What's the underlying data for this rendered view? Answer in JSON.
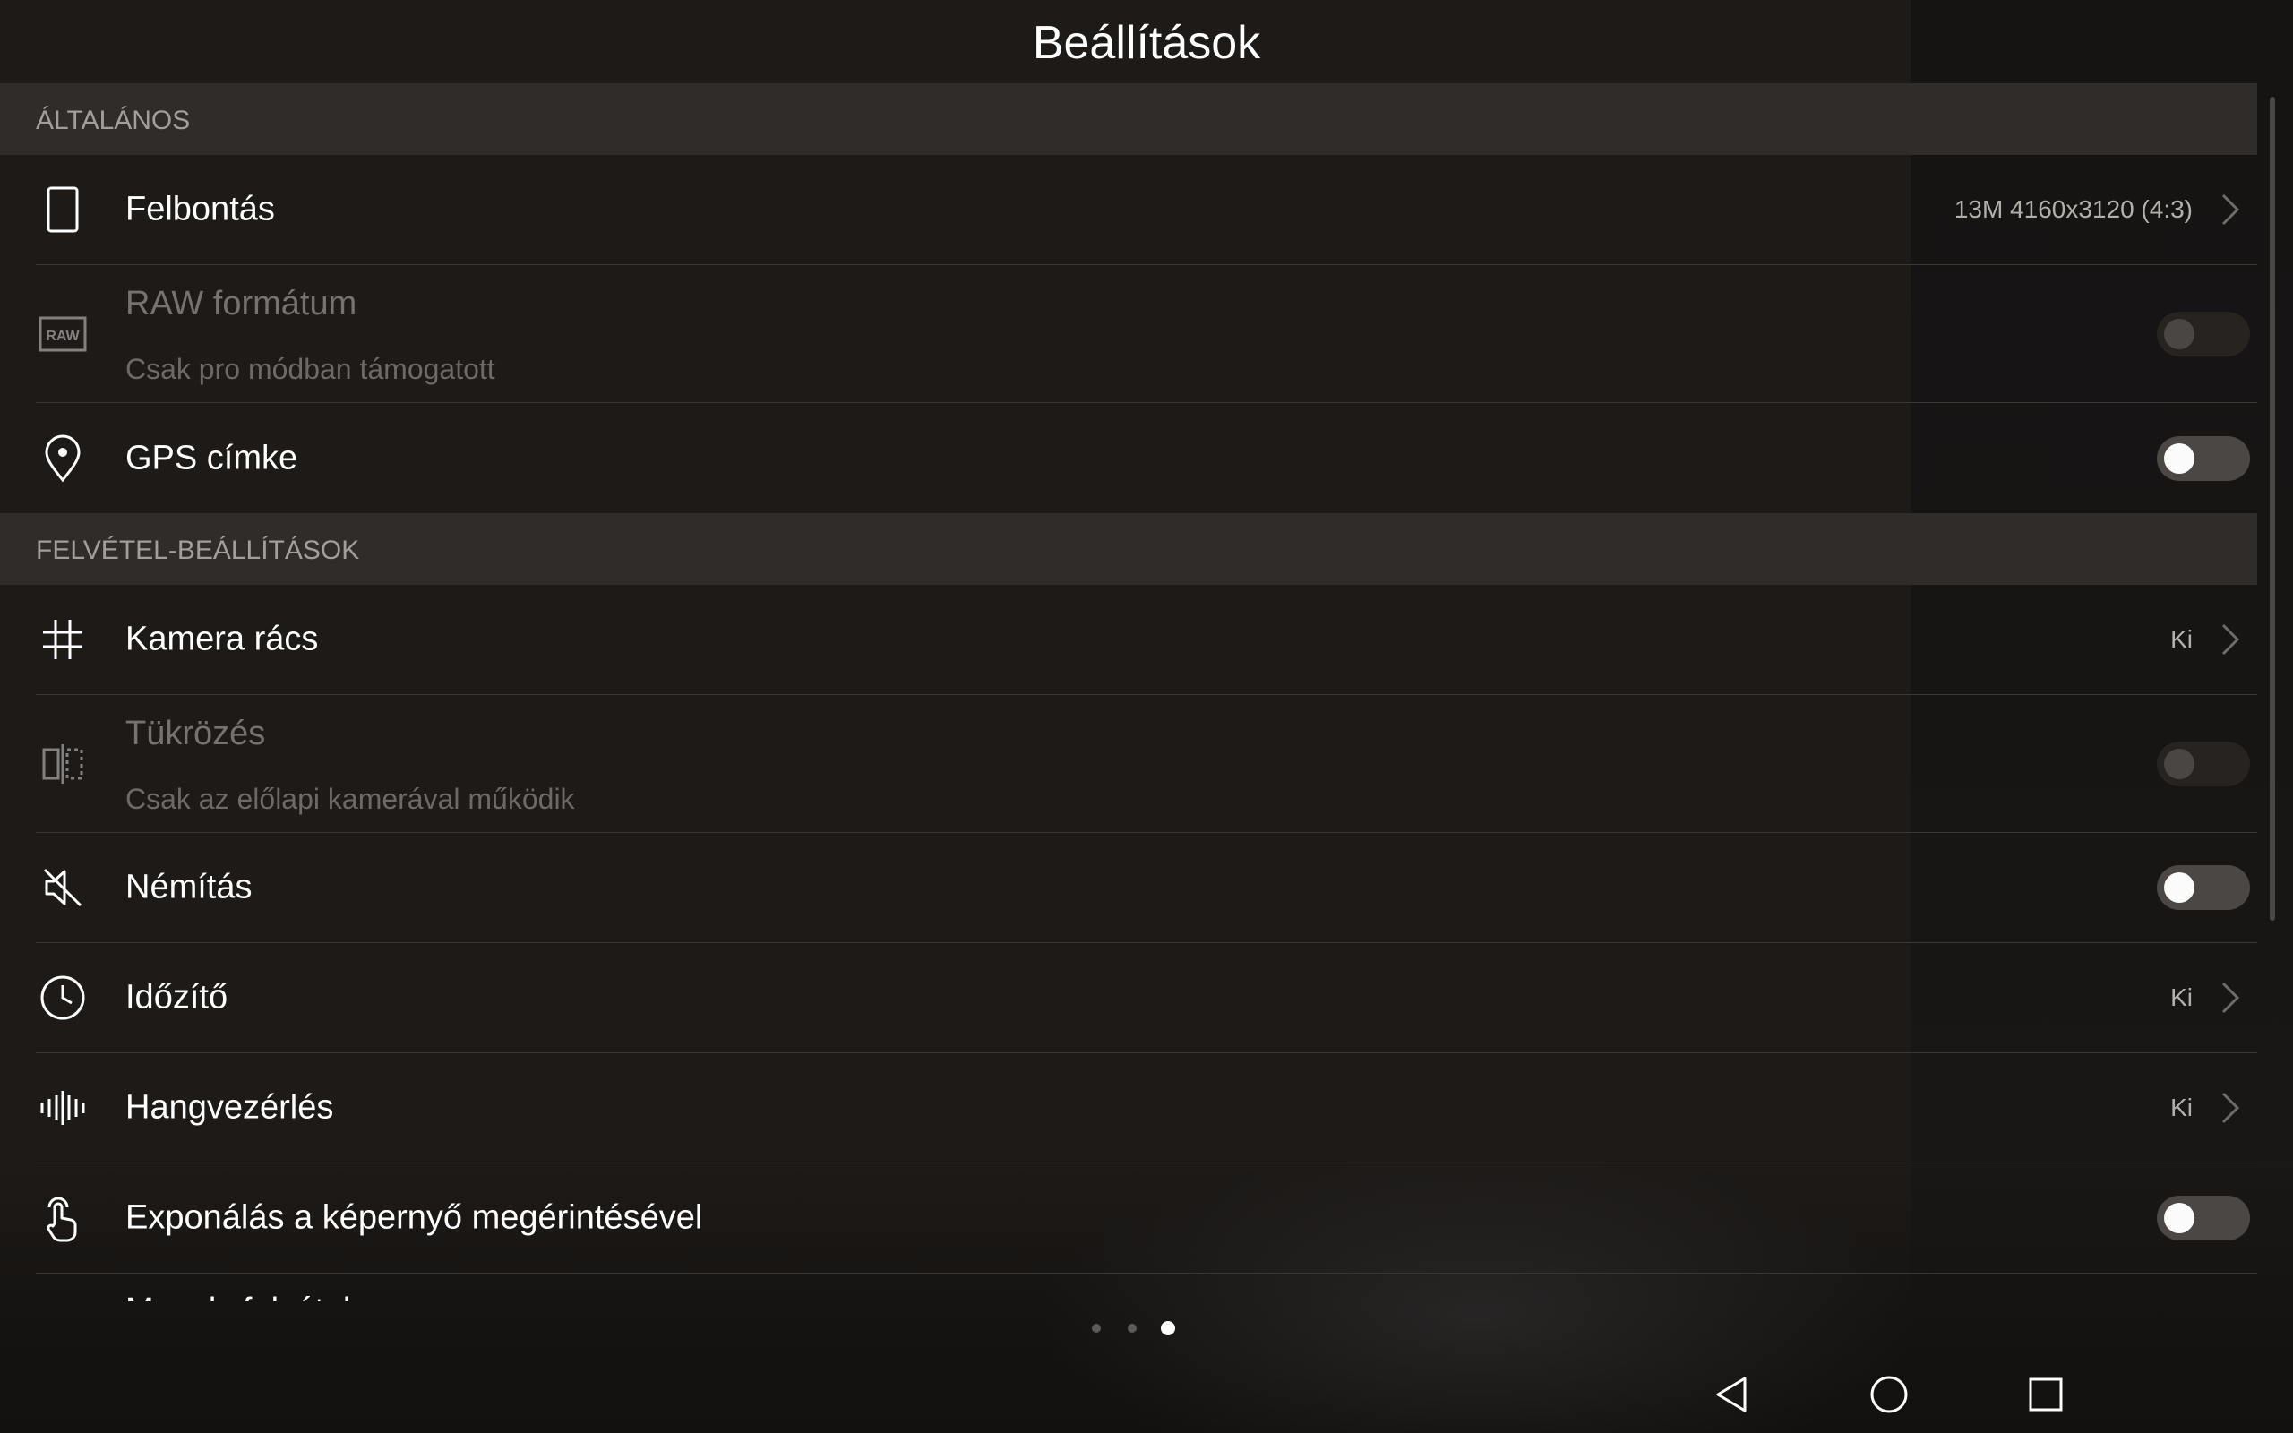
{
  "header": {
    "title": "Beállítások"
  },
  "sections": [
    {
      "title": "ÁLTALÁNOS",
      "items": [
        {
          "icon": "phone-portrait-icon",
          "label": "Felbontás",
          "value": "13M 4160x3120 (4:3)"
        },
        {
          "icon": "raw-format-icon",
          "icon_text": "RAW",
          "label": "RAW formátum",
          "sub": "Csak pro módban támogatott",
          "toggle": "off",
          "disabled": true
        },
        {
          "icon": "location-pin-icon",
          "label": "GPS címke",
          "toggle": "off"
        }
      ]
    },
    {
      "title": "FELVÉTEL-BEÁLLÍTÁSOK",
      "items": [
        {
          "icon": "grid-icon",
          "label": "Kamera rács",
          "value": "Ki"
        },
        {
          "icon": "mirror-icon",
          "label": "Tükrözés",
          "sub": "Csak az előlapi kamerával működik",
          "toggle": "off",
          "disabled": true
        },
        {
          "icon": "mute-icon",
          "label": "Némítás",
          "toggle": "off"
        },
        {
          "icon": "timer-clock-icon",
          "label": "Időzítő",
          "value": "Ki"
        },
        {
          "icon": "sound-wave-icon",
          "label": "Hangvezérlés",
          "value": "Ki"
        },
        {
          "icon": "touch-hand-icon",
          "label": "Exponálás a képernyő megérintésével",
          "toggle": "off"
        }
      ]
    }
  ],
  "partial_item": {
    "label": "Mosoly felvétele"
  },
  "pager": {
    "count": 3,
    "active": 3
  },
  "colors": {
    "background": "#1d1a18",
    "section_header": "#2f2c2a",
    "toggle_track": "#4b4745",
    "text_secondary": "#b3afab"
  },
  "navbar": {
    "icons": [
      "back-triangle-icon",
      "home-circle-icon",
      "recents-square-icon"
    ]
  }
}
